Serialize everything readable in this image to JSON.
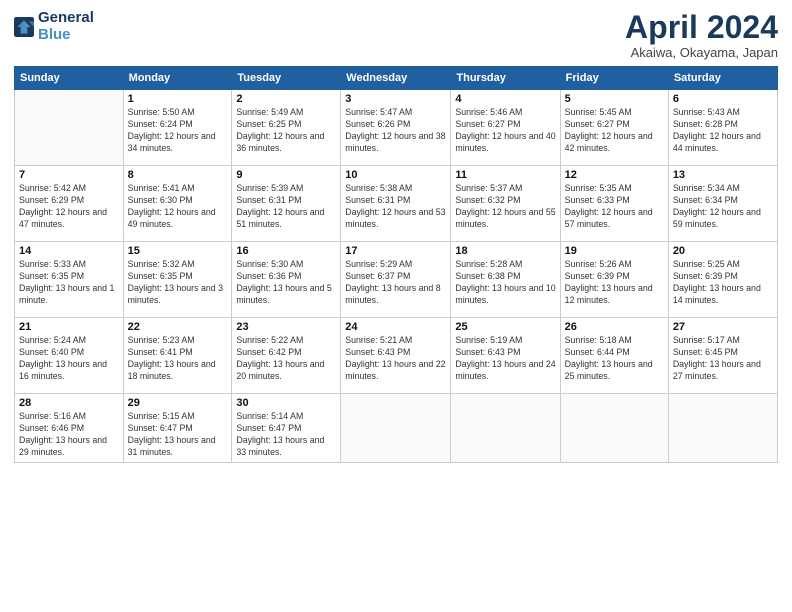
{
  "logo": {
    "line1": "General",
    "line2": "Blue"
  },
  "title": "April 2024",
  "subtitle": "Akaiwa, Okayama, Japan",
  "weekdays": [
    "Sunday",
    "Monday",
    "Tuesday",
    "Wednesday",
    "Thursday",
    "Friday",
    "Saturday"
  ],
  "weeks": [
    [
      {
        "day": "",
        "sunrise": "",
        "sunset": "",
        "daylight": ""
      },
      {
        "day": "1",
        "sunrise": "Sunrise: 5:50 AM",
        "sunset": "Sunset: 6:24 PM",
        "daylight": "Daylight: 12 hours and 34 minutes."
      },
      {
        "day": "2",
        "sunrise": "Sunrise: 5:49 AM",
        "sunset": "Sunset: 6:25 PM",
        "daylight": "Daylight: 12 hours and 36 minutes."
      },
      {
        "day": "3",
        "sunrise": "Sunrise: 5:47 AM",
        "sunset": "Sunset: 6:26 PM",
        "daylight": "Daylight: 12 hours and 38 minutes."
      },
      {
        "day": "4",
        "sunrise": "Sunrise: 5:46 AM",
        "sunset": "Sunset: 6:27 PM",
        "daylight": "Daylight: 12 hours and 40 minutes."
      },
      {
        "day": "5",
        "sunrise": "Sunrise: 5:45 AM",
        "sunset": "Sunset: 6:27 PM",
        "daylight": "Daylight: 12 hours and 42 minutes."
      },
      {
        "day": "6",
        "sunrise": "Sunrise: 5:43 AM",
        "sunset": "Sunset: 6:28 PM",
        "daylight": "Daylight: 12 hours and 44 minutes."
      }
    ],
    [
      {
        "day": "7",
        "sunrise": "Sunrise: 5:42 AM",
        "sunset": "Sunset: 6:29 PM",
        "daylight": "Daylight: 12 hours and 47 minutes."
      },
      {
        "day": "8",
        "sunrise": "Sunrise: 5:41 AM",
        "sunset": "Sunset: 6:30 PM",
        "daylight": "Daylight: 12 hours and 49 minutes."
      },
      {
        "day": "9",
        "sunrise": "Sunrise: 5:39 AM",
        "sunset": "Sunset: 6:31 PM",
        "daylight": "Daylight: 12 hours and 51 minutes."
      },
      {
        "day": "10",
        "sunrise": "Sunrise: 5:38 AM",
        "sunset": "Sunset: 6:31 PM",
        "daylight": "Daylight: 12 hours and 53 minutes."
      },
      {
        "day": "11",
        "sunrise": "Sunrise: 5:37 AM",
        "sunset": "Sunset: 6:32 PM",
        "daylight": "Daylight: 12 hours and 55 minutes."
      },
      {
        "day": "12",
        "sunrise": "Sunrise: 5:35 AM",
        "sunset": "Sunset: 6:33 PM",
        "daylight": "Daylight: 12 hours and 57 minutes."
      },
      {
        "day": "13",
        "sunrise": "Sunrise: 5:34 AM",
        "sunset": "Sunset: 6:34 PM",
        "daylight": "Daylight: 12 hours and 59 minutes."
      }
    ],
    [
      {
        "day": "14",
        "sunrise": "Sunrise: 5:33 AM",
        "sunset": "Sunset: 6:35 PM",
        "daylight": "Daylight: 13 hours and 1 minute."
      },
      {
        "day": "15",
        "sunrise": "Sunrise: 5:32 AM",
        "sunset": "Sunset: 6:35 PM",
        "daylight": "Daylight: 13 hours and 3 minutes."
      },
      {
        "day": "16",
        "sunrise": "Sunrise: 5:30 AM",
        "sunset": "Sunset: 6:36 PM",
        "daylight": "Daylight: 13 hours and 5 minutes."
      },
      {
        "day": "17",
        "sunrise": "Sunrise: 5:29 AM",
        "sunset": "Sunset: 6:37 PM",
        "daylight": "Daylight: 13 hours and 8 minutes."
      },
      {
        "day": "18",
        "sunrise": "Sunrise: 5:28 AM",
        "sunset": "Sunset: 6:38 PM",
        "daylight": "Daylight: 13 hours and 10 minutes."
      },
      {
        "day": "19",
        "sunrise": "Sunrise: 5:26 AM",
        "sunset": "Sunset: 6:39 PM",
        "daylight": "Daylight: 13 hours and 12 minutes."
      },
      {
        "day": "20",
        "sunrise": "Sunrise: 5:25 AM",
        "sunset": "Sunset: 6:39 PM",
        "daylight": "Daylight: 13 hours and 14 minutes."
      }
    ],
    [
      {
        "day": "21",
        "sunrise": "Sunrise: 5:24 AM",
        "sunset": "Sunset: 6:40 PM",
        "daylight": "Daylight: 13 hours and 16 minutes."
      },
      {
        "day": "22",
        "sunrise": "Sunrise: 5:23 AM",
        "sunset": "Sunset: 6:41 PM",
        "daylight": "Daylight: 13 hours and 18 minutes."
      },
      {
        "day": "23",
        "sunrise": "Sunrise: 5:22 AM",
        "sunset": "Sunset: 6:42 PM",
        "daylight": "Daylight: 13 hours and 20 minutes."
      },
      {
        "day": "24",
        "sunrise": "Sunrise: 5:21 AM",
        "sunset": "Sunset: 6:43 PM",
        "daylight": "Daylight: 13 hours and 22 minutes."
      },
      {
        "day": "25",
        "sunrise": "Sunrise: 5:19 AM",
        "sunset": "Sunset: 6:43 PM",
        "daylight": "Daylight: 13 hours and 24 minutes."
      },
      {
        "day": "26",
        "sunrise": "Sunrise: 5:18 AM",
        "sunset": "Sunset: 6:44 PM",
        "daylight": "Daylight: 13 hours and 25 minutes."
      },
      {
        "day": "27",
        "sunrise": "Sunrise: 5:17 AM",
        "sunset": "Sunset: 6:45 PM",
        "daylight": "Daylight: 13 hours and 27 minutes."
      }
    ],
    [
      {
        "day": "28",
        "sunrise": "Sunrise: 5:16 AM",
        "sunset": "Sunset: 6:46 PM",
        "daylight": "Daylight: 13 hours and 29 minutes."
      },
      {
        "day": "29",
        "sunrise": "Sunrise: 5:15 AM",
        "sunset": "Sunset: 6:47 PM",
        "daylight": "Daylight: 13 hours and 31 minutes."
      },
      {
        "day": "30",
        "sunrise": "Sunrise: 5:14 AM",
        "sunset": "Sunset: 6:47 PM",
        "daylight": "Daylight: 13 hours and 33 minutes."
      },
      {
        "day": "",
        "sunrise": "",
        "sunset": "",
        "daylight": ""
      },
      {
        "day": "",
        "sunrise": "",
        "sunset": "",
        "daylight": ""
      },
      {
        "day": "",
        "sunrise": "",
        "sunset": "",
        "daylight": ""
      },
      {
        "day": "",
        "sunrise": "",
        "sunset": "",
        "daylight": ""
      }
    ]
  ]
}
